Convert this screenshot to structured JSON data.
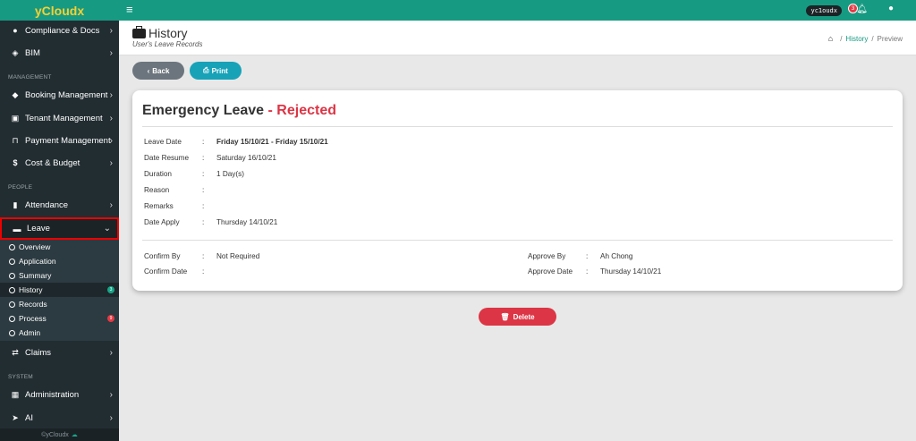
{
  "app": {
    "brand": "yCloudx",
    "footer": "©yCloudx"
  },
  "topbar": {
    "user": "yc1oudx",
    "notifications": "3"
  },
  "sidebar": {
    "items": [
      {
        "label": "Compliance & Docs",
        "icon": "gear-icon"
      },
      {
        "label": "BIM",
        "icon": "cube-icon"
      },
      {
        "label": "Booking Management",
        "icon": "tag-icon"
      },
      {
        "label": "Tenant Management",
        "icon": "building-icon"
      },
      {
        "label": "Payment Management",
        "icon": "cart-icon"
      },
      {
        "label": "Cost & Budget",
        "icon": "dollar-icon"
      },
      {
        "label": "Attendance",
        "icon": "book-icon"
      },
      {
        "label": "Leave",
        "icon": "briefcase-icon"
      },
      {
        "label": "Claims",
        "icon": "exchange-icon"
      },
      {
        "label": "Administration",
        "icon": "id-card-icon"
      },
      {
        "label": "AI",
        "icon": "send-icon"
      }
    ],
    "sections": {
      "management": "MANAGEMENT",
      "people": "PEOPLE",
      "system": "SYSTEM"
    },
    "leave_sub": [
      {
        "label": "Overview"
      },
      {
        "label": "Application"
      },
      {
        "label": "Summary"
      },
      {
        "label": "History",
        "badge": "3"
      },
      {
        "label": "Records"
      },
      {
        "label": "Process",
        "badge": "9"
      },
      {
        "label": "Admin"
      }
    ]
  },
  "header": {
    "title": "History",
    "subtitle": "User's Leave Records",
    "breadcrumb": [
      "History",
      "Preview"
    ]
  },
  "actions": {
    "back": "Back",
    "print": "Print",
    "delete": "Delete"
  },
  "leave": {
    "type": "Emergency Leave",
    "separator": " - ",
    "status": "Rejected",
    "details": [
      {
        "label": "Leave Date",
        "value": "Friday 15/10/21 - Friday 15/10/21"
      },
      {
        "label": "Date Resume",
        "value": "Saturday 16/10/21"
      },
      {
        "label": "Duration",
        "value": "1 Day(s)"
      },
      {
        "label": "Reason",
        "value": ""
      },
      {
        "label": "Remarks",
        "value": ""
      },
      {
        "label": "Date Apply",
        "value": "Thursday 14/10/21"
      }
    ],
    "confirm": [
      {
        "label": "Confirm By",
        "value": "Not Required"
      },
      {
        "label": "Confirm Date",
        "value": ""
      }
    ],
    "approve": [
      {
        "label": "Approve By",
        "value": "Ah Chong"
      },
      {
        "label": "Approve Date",
        "value": "Thursday 14/10/21"
      }
    ]
  },
  "colors": {
    "primary": "#179a82",
    "sidebar": "#222d32",
    "danger": "#dc3545",
    "info": "#17a2b8",
    "secondary": "#6c757d"
  }
}
